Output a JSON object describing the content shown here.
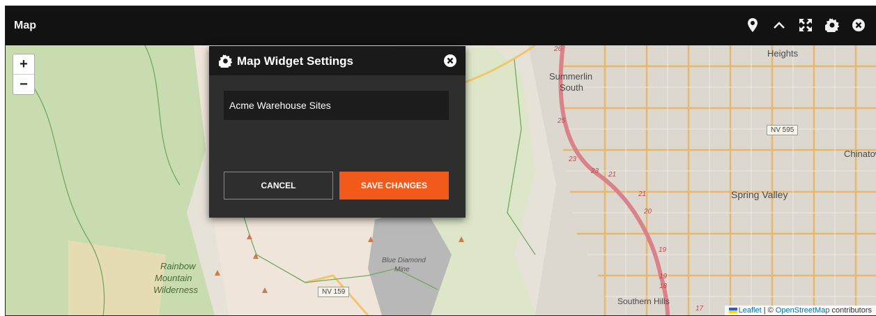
{
  "header": {
    "title": "Map",
    "icons": [
      "map-marker-icon",
      "chevron-up-icon",
      "expand-icon",
      "gear-icon",
      "close-circle-icon"
    ]
  },
  "map": {
    "zoom_in": "+",
    "zoom_out": "−",
    "labels": {
      "heights": "Heights",
      "summerlin": "Summerlin",
      "south": "South",
      "nv595": "NV 595",
      "chinatown": "Chinatow",
      "spring_valley": "Spring Valley",
      "rainbow": "Rainbow",
      "mountain": "Mountain",
      "wilderness": "Wilderness",
      "blue_diamond": "Blue Diamond",
      "mine": "Mine",
      "nv159": "NV 159",
      "southern_hills": "Southern Hills"
    },
    "route_numbers": [
      "26",
      "25",
      "23",
      "23",
      "21",
      "21",
      "20",
      "19",
      "19",
      "18",
      "17"
    ],
    "attribution": {
      "leaflet": "Leaflet",
      "separator": "| ©",
      "osm": "OpenStreetMap",
      "contributors": "contributors"
    }
  },
  "dialog": {
    "title": "Map Widget Settings",
    "name_value": "Acme Warehouse Sites",
    "cancel_label": "CANCEL",
    "save_label": "SAVE CHANGES"
  },
  "colors": {
    "header_bg": "#121212",
    "dialog_bg": "#2e2e2e",
    "accent": "#f15a1a"
  }
}
